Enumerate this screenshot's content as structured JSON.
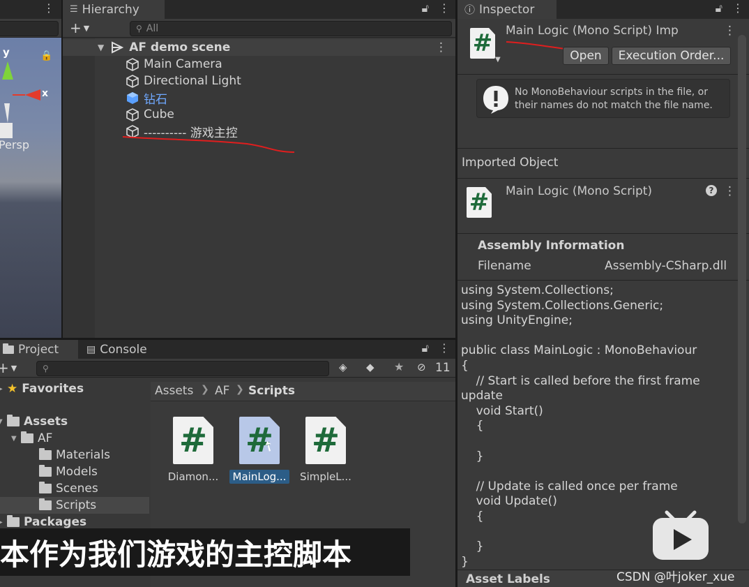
{
  "hierarchy": {
    "tab_label": "Hierarchy",
    "search_placeholder": "All",
    "scene_name": "AF demo scene",
    "items": [
      {
        "label": "Main Camera",
        "kind": "object"
      },
      {
        "label": "Directional Light",
        "kind": "object"
      },
      {
        "label": "钻石",
        "kind": "prefab"
      },
      {
        "label": "Cube",
        "kind": "object"
      },
      {
        "label": "---------- 游戏主控",
        "kind": "object"
      }
    ]
  },
  "scene": {
    "axis_y": "y",
    "axis_x": "x",
    "projection_label": "Persp"
  },
  "inspector": {
    "tab_label": "Inspector",
    "header_title": "Main Logic (Mono Script) Imp",
    "open_button": "Open",
    "execution_order_button": "Execution Order...",
    "warning_text": "No MonoBehaviour scripts in the file, or their names do not match the file name.",
    "imported_object_label": "Imported Object",
    "script_title": "Main Logic (Mono Script)",
    "assembly_heading": "Assembly Information",
    "filename_label": "Filename",
    "filename_value": "Assembly-CSharp.dll",
    "code": "using System.Collections;\nusing System.Collections.Generic;\nusing UnityEngine;\n\npublic class MainLogic : MonoBehaviour\n{\n    // Start is called before the first frame\nupdate\n    void Start()\n    {\n\n    }\n\n    // Update is called once per frame\n    void Update()\n    {\n\n    }\n}",
    "asset_labels": "Asset Labels"
  },
  "project": {
    "project_tab": "Project",
    "console_tab": "Console",
    "hidden_count": "11",
    "favorites": "Favorites",
    "assets": "Assets",
    "af": "AF",
    "folders": [
      "Materials",
      "Models",
      "Scenes",
      "Scripts"
    ],
    "packages": "Packages",
    "breadcrumb": [
      "Assets",
      "AF",
      "Scripts"
    ],
    "files": [
      {
        "label": "Diamon...",
        "selected": false
      },
      {
        "label": "MainLog...",
        "selected": true
      },
      {
        "label": "SimpleL...",
        "selected": false
      }
    ]
  },
  "overlay": {
    "subtitle": "本作为我们游戏的主控脚本",
    "watermark": "CSDN @叶joker_xue"
  },
  "colors": {
    "panel": "#383838",
    "tabbar": "#282828",
    "selection": "#2c5d87",
    "prefab_blue": "#6fa8ff",
    "annotation_red": "#e01e1e",
    "script_green": "#1e6a3a"
  }
}
